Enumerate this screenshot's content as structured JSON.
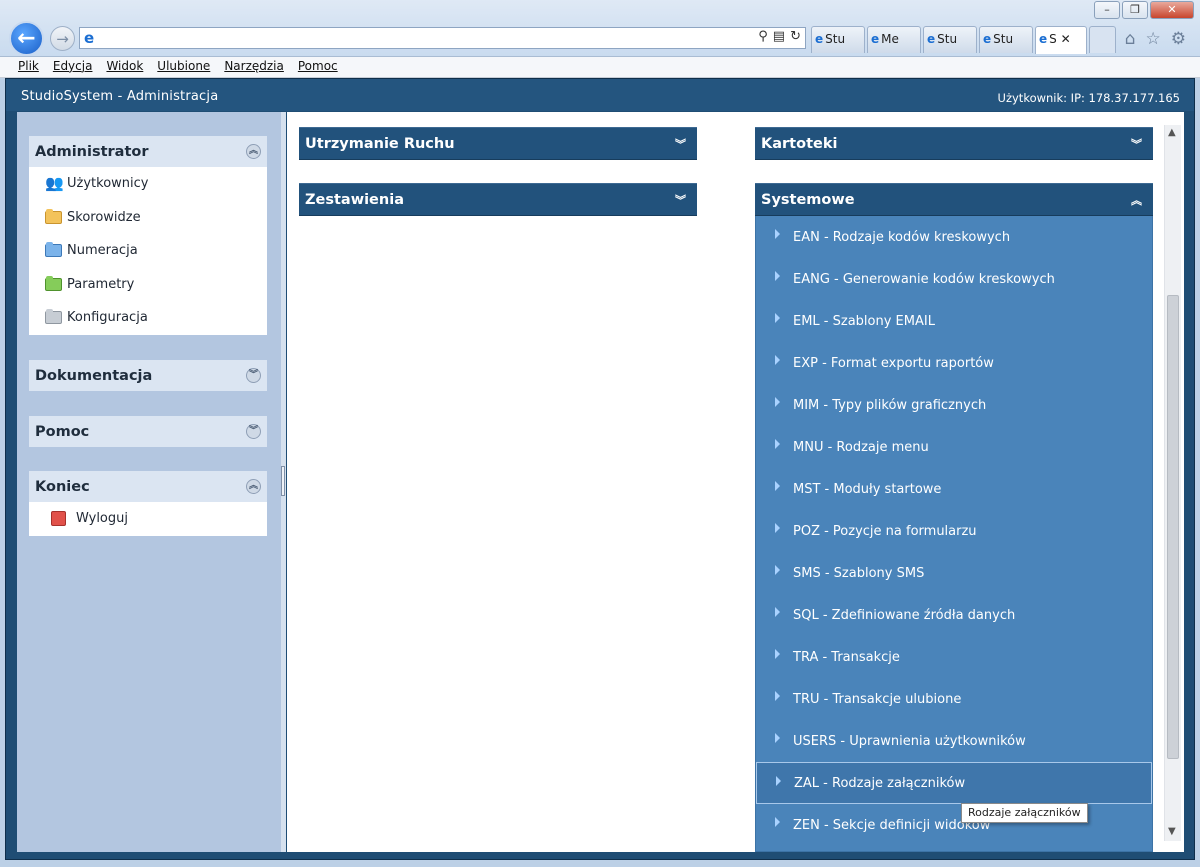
{
  "browser": {
    "tabs": [
      {
        "label": "Stu"
      },
      {
        "label": "Me"
      },
      {
        "label": "Stu"
      },
      {
        "label": "Stu"
      },
      {
        "label": "S",
        "active": true
      }
    ],
    "tab_close": "✕",
    "window_controls": [
      "minimize",
      "restore",
      "close"
    ]
  },
  "menubar": [
    "Plik",
    "Edycja",
    "Widok",
    "Ulubione",
    "Narzędzia",
    "Pomoc"
  ],
  "app": {
    "title": "StudioSystem - Administracja",
    "user_info": "Użytkownik: IP: 178.37.177.165"
  },
  "sidebar": {
    "administrator": {
      "title": "Administrator",
      "items": [
        {
          "label": "Użytkownicy",
          "icon": "users-icon"
        },
        {
          "label": "Skorowidze",
          "icon": "folder-yellow-icon"
        },
        {
          "label": "Numeracja",
          "icon": "folder-blue-icon"
        },
        {
          "label": "Parametry",
          "icon": "folder-green-icon"
        },
        {
          "label": "Konfiguracja",
          "icon": "folder-grey-icon"
        }
      ]
    },
    "dokumentacja": {
      "title": "Dokumentacja"
    },
    "pomoc": {
      "title": "Pomoc"
    },
    "koniec": {
      "title": "Koniec",
      "items": [
        {
          "label": "Wyloguj",
          "icon": "logout-icon"
        }
      ]
    }
  },
  "panels": {
    "utrzymanie": {
      "title": "Utrzymanie Ruchu"
    },
    "zestawienia": {
      "title": "Zestawienia"
    },
    "kartoteki": {
      "title": "Kartoteki"
    },
    "systemowe": {
      "title": "Systemowe",
      "items": [
        "EAN - Rodzaje kodów kreskowych",
        "EANG - Generowanie kodów kreskowych",
        "EML - Szablony EMAIL",
        "EXP - Format exportu raportów",
        "MIM - Typy plików graficznych",
        "MNU - Rodzaje menu",
        "MST - Moduły startowe",
        "POZ - Pozycje na formularzu",
        "SMS - Szablony SMS",
        "SQL - Zdefiniowane źródła danych",
        "TRA - Transakcje",
        "TRU - Transakcje ulubione",
        "USERS - Uprawnienia użytkowników",
        "ZAL - Rodzaje załączników",
        "ZEN - Sekcje definicji widoków"
      ],
      "hovered_index": 13
    }
  },
  "tooltip": "Rodzaje załączników",
  "colors": {
    "header": "#24557f",
    "panel_head": "#22527c",
    "panel_body": "#4a84ba",
    "sidebar": "#b3c6e0"
  }
}
